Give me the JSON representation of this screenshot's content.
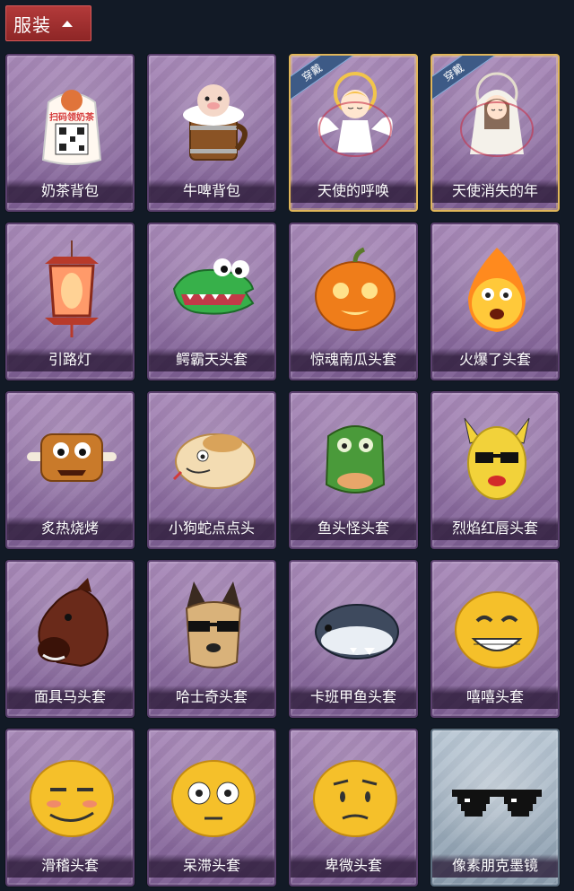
{
  "header": {
    "title": "服装",
    "toggle_icon": "chevron-up-icon"
  },
  "worn_badge": "穿戴",
  "items": [
    {
      "name": "奶茶背包",
      "icon": "milk-tea-backpack-icon",
      "worn": false,
      "art_text": "扫码领奶茶"
    },
    {
      "name": "牛啤背包",
      "icon": "beer-barrel-backpack-icon",
      "worn": false
    },
    {
      "name": "天使的呼唤",
      "icon": "angel-figure-icon",
      "worn": true
    },
    {
      "name": "天使消失的年",
      "icon": "veiled-angel-figure-icon",
      "worn": true
    },
    {
      "name": "引路灯",
      "icon": "lantern-icon",
      "worn": false
    },
    {
      "name": "鳄霸天头套",
      "icon": "crocodile-head-icon",
      "worn": false
    },
    {
      "name": "惊魂南瓜头套",
      "icon": "pumpkin-head-icon",
      "worn": false
    },
    {
      "name": "火爆了头套",
      "icon": "fire-head-icon",
      "worn": false
    },
    {
      "name": "炙热烧烤",
      "icon": "bbq-meat-icon",
      "worn": false
    },
    {
      "name": "小狗蛇点点头",
      "icon": "dog-snake-head-icon",
      "worn": false
    },
    {
      "name": "鱼头怪头套",
      "icon": "fish-head-icon",
      "worn": false
    },
    {
      "name": "烈焰红唇头套",
      "icon": "yellow-mask-sunglasses-icon",
      "worn": false
    },
    {
      "name": "面具马头套",
      "icon": "horse-head-icon",
      "worn": false
    },
    {
      "name": "哈士奇头套",
      "icon": "husky-head-icon",
      "worn": false
    },
    {
      "name": "卡班甲鱼头套",
      "icon": "turtle-head-icon",
      "worn": false
    },
    {
      "name": "嘻嘻头套",
      "icon": "grin-emoji-head-icon",
      "worn": false
    },
    {
      "name": "滑稽头套",
      "icon": "smirk-emoji-head-icon",
      "worn": false
    },
    {
      "name": "呆滞头套",
      "icon": "stunned-emoji-head-icon",
      "worn": false
    },
    {
      "name": "卑微头套",
      "icon": "humble-emoji-head-icon",
      "worn": false
    },
    {
      "name": "像素朋克墨镜",
      "icon": "pixel-sunglasses-icon",
      "worn": false
    }
  ],
  "colors": {
    "background": "#121a26",
    "card_purple": "#8f70a6",
    "card_silver": "#a0b1c1",
    "header_red": "#a33232",
    "worn_border": "#e0b65a"
  }
}
